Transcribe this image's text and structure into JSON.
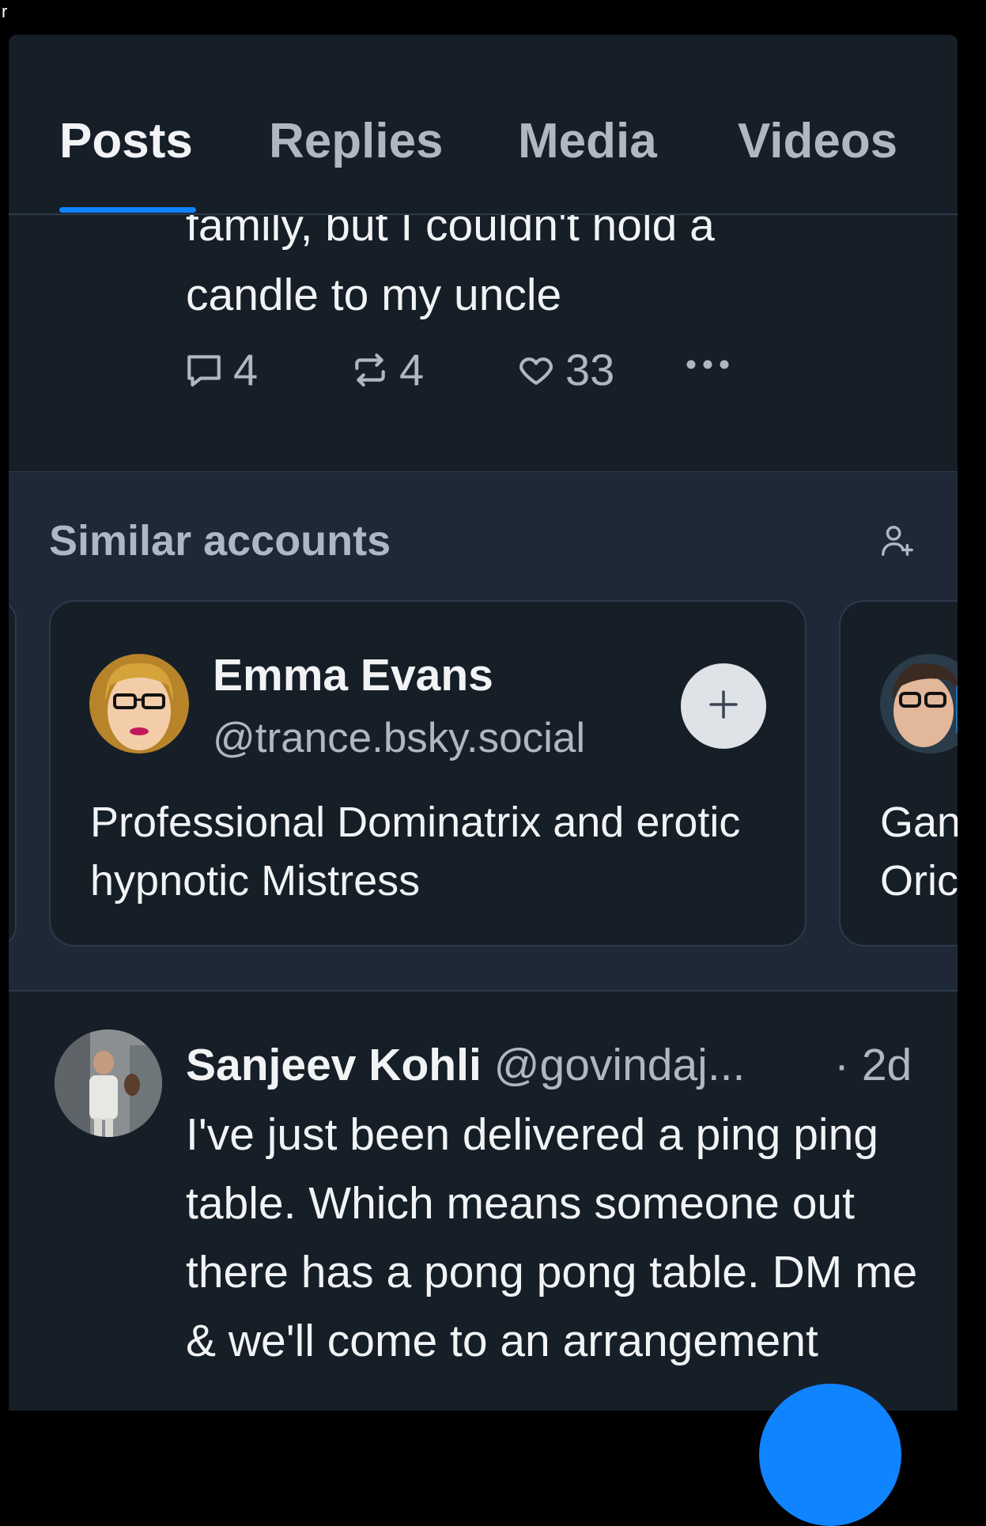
{
  "corner_char": "r",
  "tabs": [
    {
      "label": "Posts",
      "active": true
    },
    {
      "label": "Replies",
      "active": false
    },
    {
      "label": "Media",
      "active": false
    },
    {
      "label": "Videos",
      "active": false
    }
  ],
  "top_post": {
    "text_line1": "family, but I couldn't hold a",
    "text_line2": "candle to my uncle",
    "replies": "4",
    "reposts": "4",
    "likes": "33",
    "more_icon": "more-horizontal-icon"
  },
  "similar": {
    "title": "Similar accounts",
    "main_card": {
      "name": "Emma Evans",
      "handle": "@trance.bsky.social",
      "bio": "Professional Dominatrix and erotic hypnotic Mistress",
      "follow_icon": "plus-icon"
    },
    "right_card": {
      "bio_line1": "Gan",
      "bio_line2": "Oric"
    }
  },
  "post": {
    "author_name": "Sanjeev Kohli",
    "author_handle": "@govindaj...",
    "time": "· 2d",
    "body": "I've just been delivered a ping ping table. Which means someone out there has a pong pong table. DM me & we'll come to an arrangement"
  },
  "colors": {
    "accent": "#1083fe",
    "panel_bg": "#161e27",
    "section_bg": "#1e2836",
    "muted_text": "#aeb7c2"
  }
}
